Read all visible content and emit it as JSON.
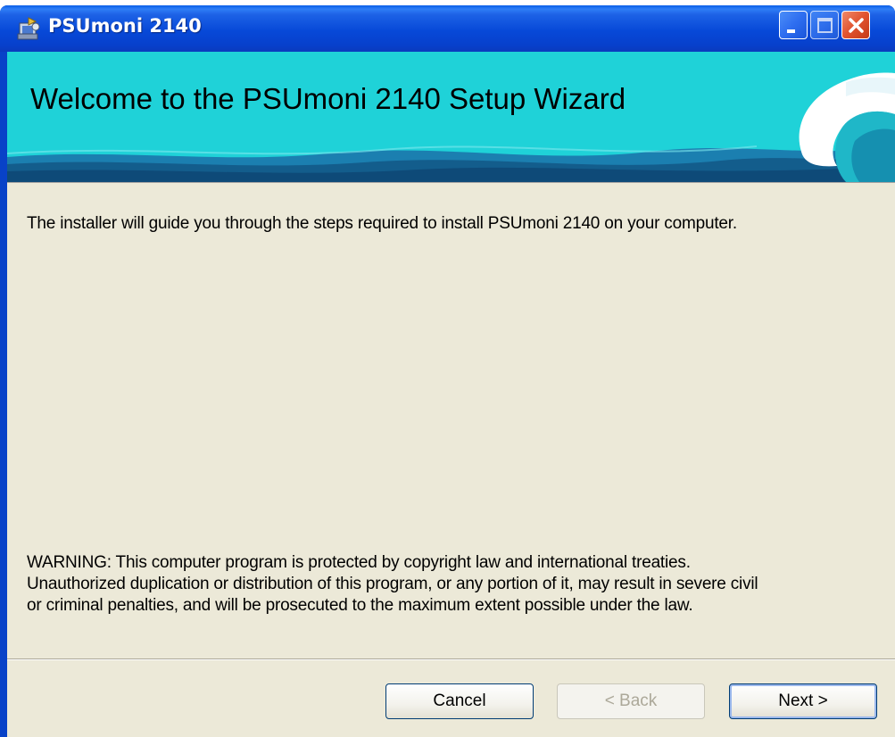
{
  "window": {
    "title": "PSUmoni 2140",
    "icon": "installer-icon"
  },
  "title_controls": {
    "minimize_icon": "minimize-icon",
    "maximize_icon": "maximize-icon",
    "close_icon": "close-icon"
  },
  "banner": {
    "title": "Welcome to the PSUmoni 2140 Setup Wizard",
    "background_color": "#1fd2d8"
  },
  "body": {
    "intro": "The installer will guide you through the steps required to install PSUmoni 2140 on your computer.",
    "warning_lines": [
      "WARNING: This computer program is protected by copyright law and international treaties.",
      "Unauthorized duplication or distribution of this program, or any portion of it, may result in severe civil",
      "or criminal penalties, and will be prosecuted to the maximum extent possible under the law."
    ]
  },
  "buttons": {
    "cancel": "Cancel",
    "back": "< Back",
    "next": "Next >"
  },
  "colors": {
    "titlebar": "#0749d8",
    "dialog_face": "#ece9d8",
    "close_button": "#e0522e"
  }
}
